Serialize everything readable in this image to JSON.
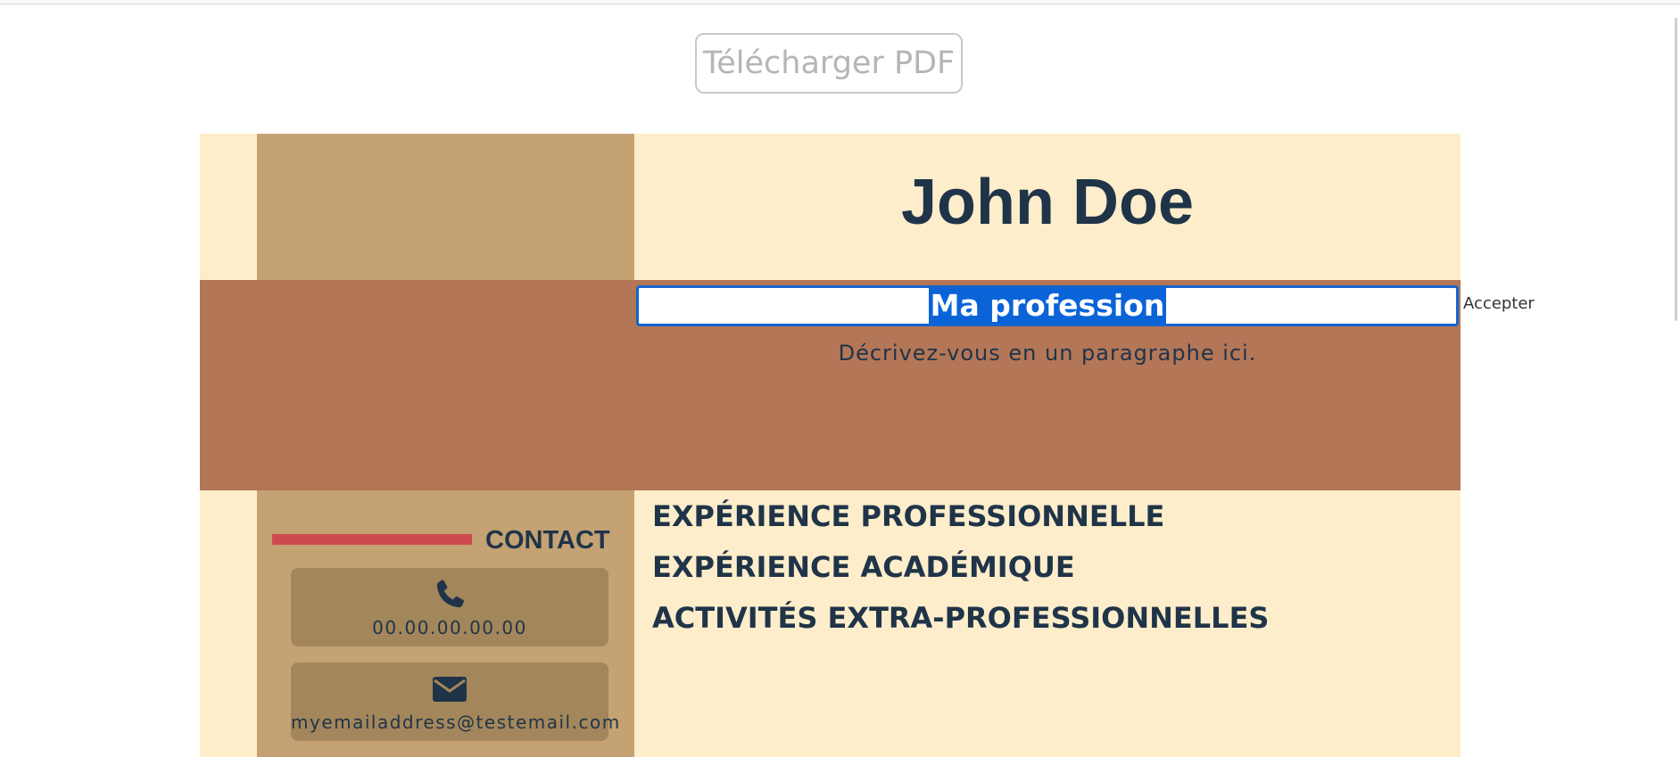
{
  "toolbar": {
    "download_label": "Télécharger PDF"
  },
  "cv": {
    "name": "John Doe",
    "profession": "Ma profession",
    "accept_label": "Accepter",
    "description": "Décrivez-vous en un paragraphe ici.",
    "contact": {
      "title": "CONTACT",
      "phone": "00.00.00.00.00",
      "email": "myemailaddress@testemail.com"
    },
    "sections": [
      "EXPÉRIENCE PROFESSIONNELLE",
      "EXPÉRIENCE ACADÉMIQUE",
      "ACTIVITÉS EXTRA-PROFESSIONNELLES"
    ]
  },
  "colors": {
    "background": "#fdedcb",
    "sidebar": "#c4a273",
    "band": "#b37657",
    "accent_red": "#cf4a4f",
    "card": "#a3865b",
    "text_dark": "#1f3448",
    "selection_blue": "#0a64d8"
  },
  "icons": {
    "phone": "phone-icon",
    "email": "envelope-icon"
  }
}
